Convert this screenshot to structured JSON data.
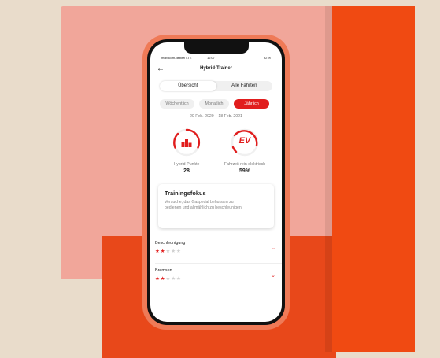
{
  "status": {
    "carrier": "mobilcom-debitel LTE",
    "time": "11:07",
    "battery": "92 %"
  },
  "nav": {
    "title": "Hybrid-Trainer"
  },
  "tabs": [
    {
      "label": "Übersicht"
    },
    {
      "label": "Alle Fahrten"
    }
  ],
  "periods": [
    {
      "label": "Wöchentlich"
    },
    {
      "label": "Monatlich"
    },
    {
      "label": "Jährlich"
    }
  ],
  "selected_period": "Jährlich",
  "date_range": "20 Feb. 2020 – 18 Feb. 2021",
  "stats": [
    {
      "label": "Hybrid-Punkte",
      "value": "28",
      "icon": "podium-icon"
    },
    {
      "label": "Fahrzeit rein elektrisch",
      "value": "59%",
      "icon": "ev-icon",
      "badge": "EV"
    }
  ],
  "training": {
    "title": "Trainingsfokus",
    "text": "Versuche, das Gaspedal behutsam zu bedienen und allmählich zu beschleunigen."
  },
  "ratings": [
    {
      "label": "Beschleunigung",
      "stars": 2,
      "max": 5
    },
    {
      "label": "Bremsen",
      "stars": 2,
      "max": 5
    }
  ],
  "colors": {
    "accent": "#e11d1d",
    "phone_case": "#ef7a57"
  }
}
